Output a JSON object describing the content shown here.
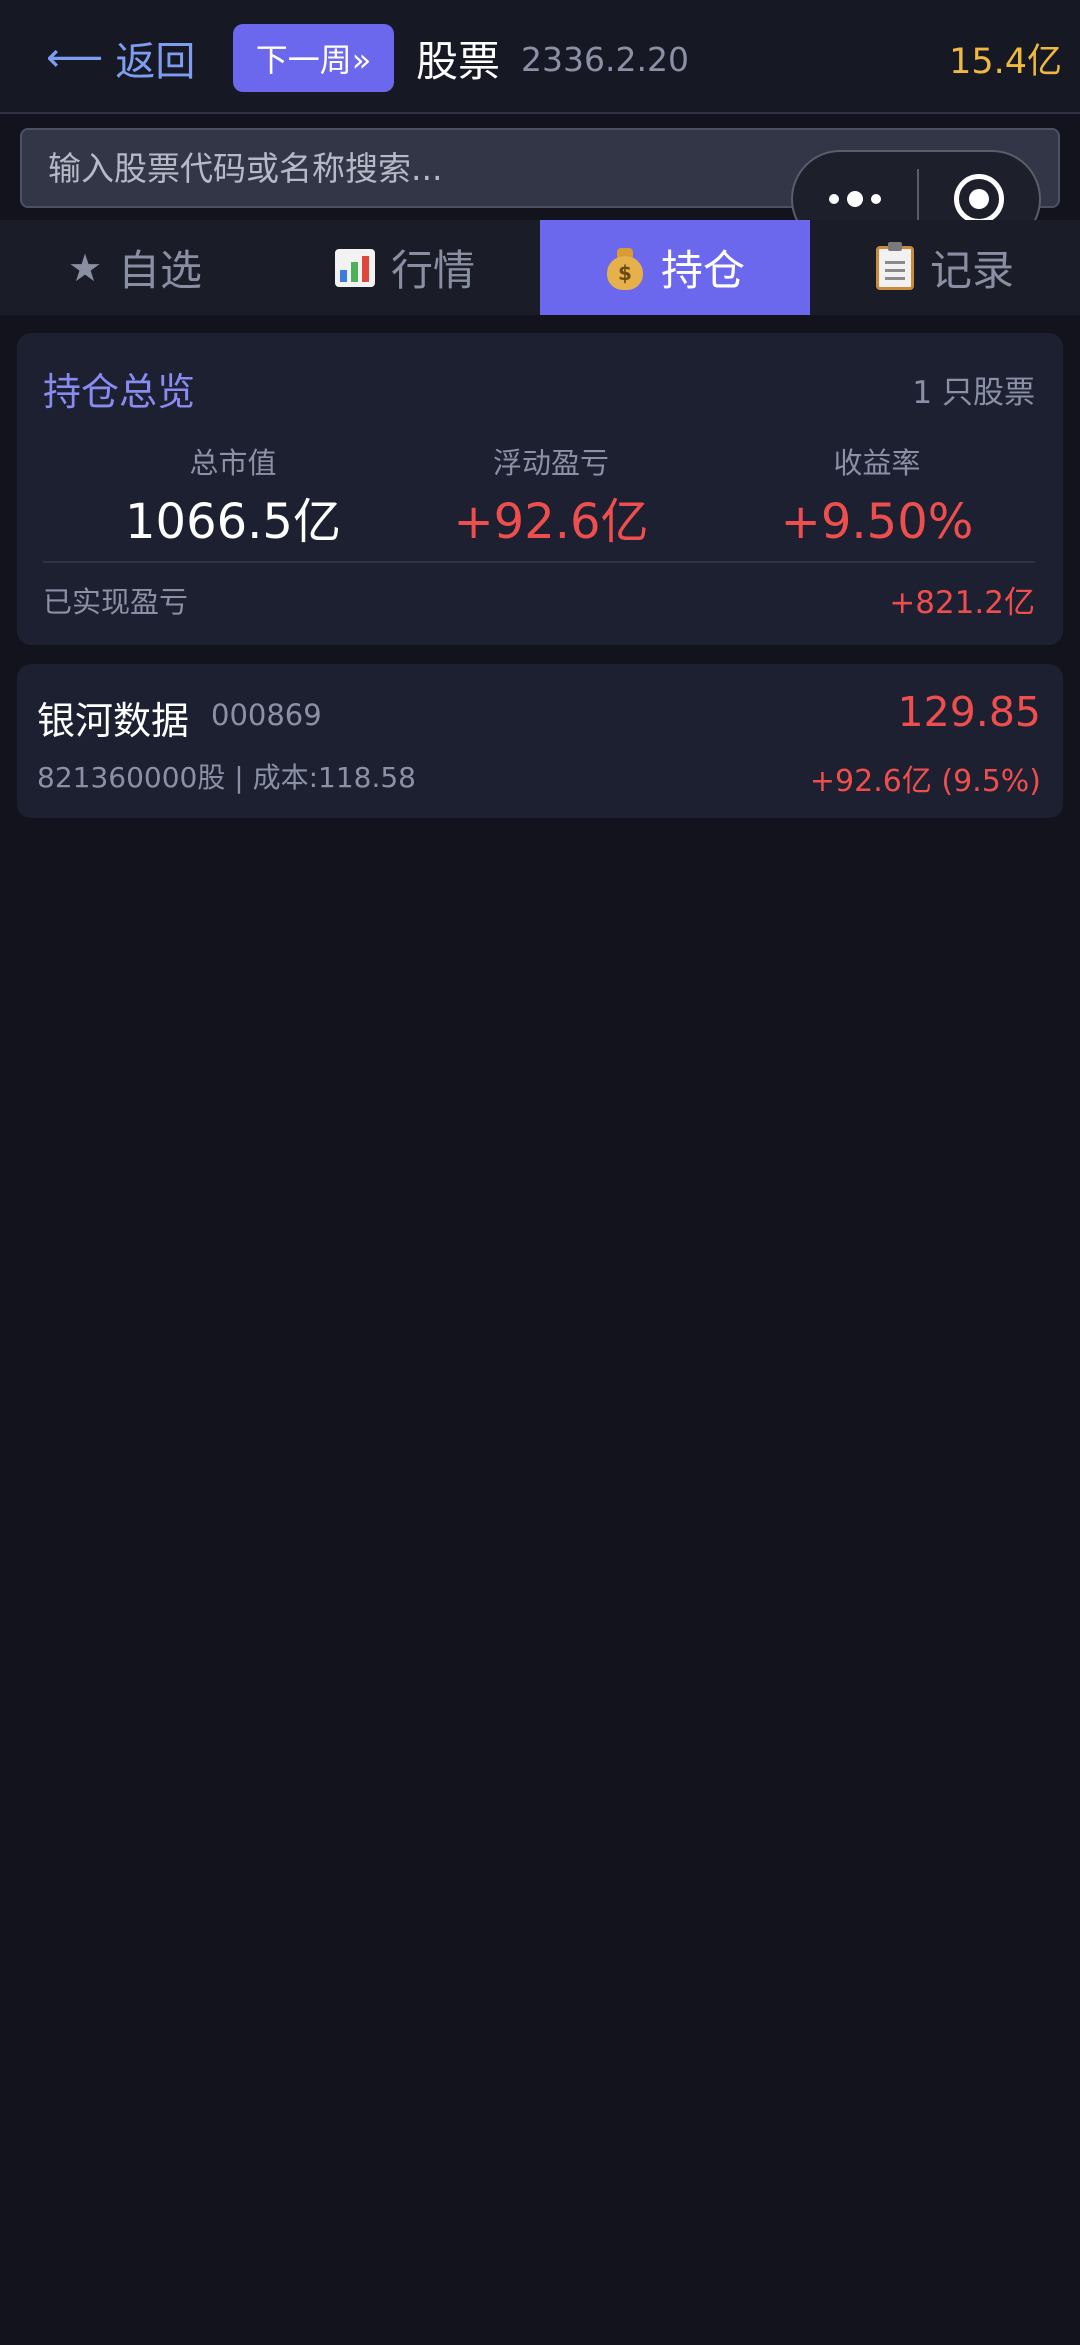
{
  "header": {
    "back_label": "返回",
    "back_icon": "left-arrow-icon",
    "next_week_label": "下一周»",
    "title": "股票",
    "date": "2336.2.20",
    "balance": "15.4亿"
  },
  "search": {
    "placeholder": "输入股票代码或名称搜索..."
  },
  "capsule": {
    "more_icon": "more-dots-icon",
    "close_icon": "target-circle-icon"
  },
  "tabs": [
    {
      "icon": "star-icon",
      "label": "自选",
      "active": false
    },
    {
      "icon": "bar-chart-icon",
      "label": "行情",
      "active": false
    },
    {
      "icon": "money-bag-icon",
      "label": "持仓",
      "active": true
    },
    {
      "icon": "clipboard-icon",
      "label": "记录",
      "active": false
    }
  ],
  "summary": {
    "title": "持仓总览",
    "count": "1 只股票",
    "metrics": [
      {
        "label": "总市值",
        "value": "1066.5亿"
      },
      {
        "label": "浮动盈亏",
        "value": "+92.6亿"
      },
      {
        "label": "收益率",
        "value": "+9.50%"
      }
    ],
    "realized_label": "已实现盈亏",
    "realized_value": "+821.2亿"
  },
  "holdings": [
    {
      "name": "银河数据",
      "code": "000869",
      "shares_cost": "821360000股 | 成本:118.58",
      "price": "129.85",
      "pnl": "+92.6亿 (9.5%)"
    }
  ],
  "colors": {
    "accent": "#6c68ee",
    "up_red": "#ef4e4e",
    "balance_gold": "#f0b83c",
    "background": "#12131c",
    "card": "#1d2030"
  }
}
